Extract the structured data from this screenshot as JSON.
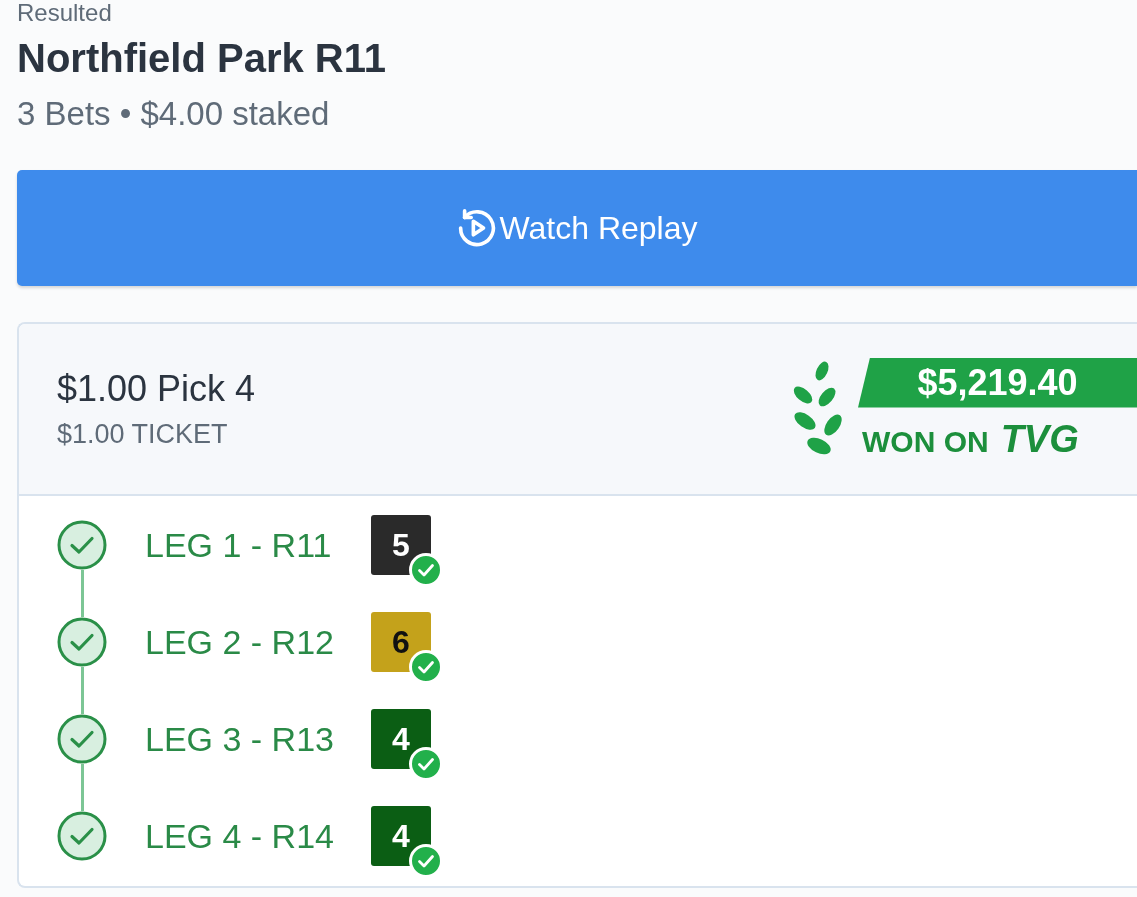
{
  "header": {
    "status": "Resulted",
    "title": "Northfield Park R11",
    "summary": "3 Bets • $4.00 staked"
  },
  "replay_button": {
    "label": "Watch Replay"
  },
  "bet": {
    "title": "$1.00 Pick 4",
    "ticket": "$1.00 TICKET",
    "win": {
      "amount": "$5,219.40",
      "label": "WON ON",
      "brand": "TVG"
    },
    "legs": [
      {
        "label": "LEG 1 - R11",
        "won": true,
        "selection": {
          "number": "5",
          "color": "#2a2a2a",
          "won": true
        }
      },
      {
        "label": "LEG 2 - R12",
        "won": true,
        "selection": {
          "number": "6",
          "color": "#c4a21b",
          "won": true
        }
      },
      {
        "label": "LEG 3 - R13",
        "won": true,
        "selection": {
          "number": "4",
          "color": "#0b5e14",
          "won": true
        }
      },
      {
        "label": "LEG 4 - R14",
        "won": true,
        "selection": {
          "number": "4",
          "color": "#0b5e14",
          "won": true
        }
      }
    ]
  }
}
